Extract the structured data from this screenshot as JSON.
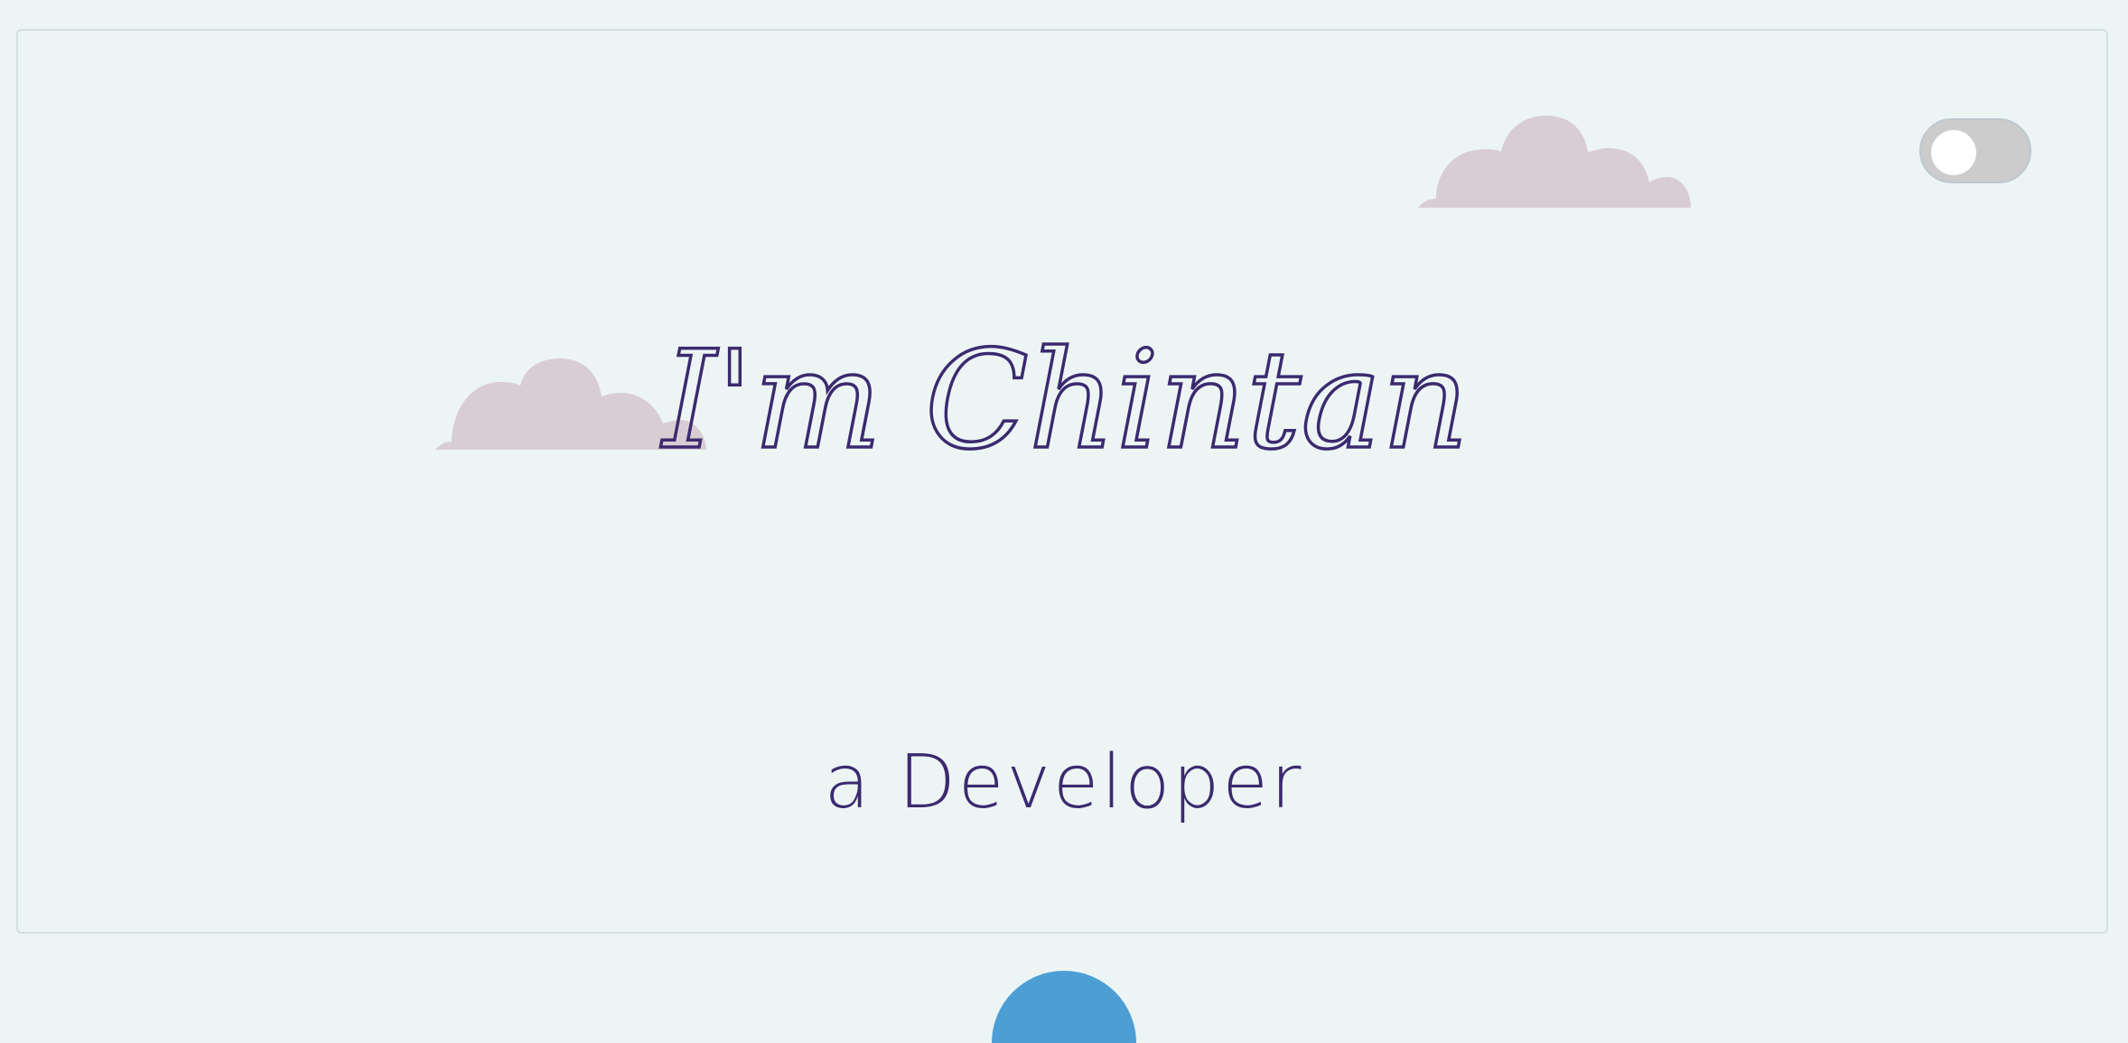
{
  "hero": {
    "greeting": "I'm Chintan",
    "subtitle": "a Developer"
  },
  "theme_toggle": {
    "state": "off"
  },
  "colors": {
    "background": "#ecf5f4",
    "text": "#3b2a6f",
    "cloud": "#d9cdd4",
    "toggle_track": "#cccccc",
    "toggle_knob": "#ffffff",
    "accent": "#4d9ed5"
  },
  "icons": {
    "cloud": "cloud-icon"
  }
}
